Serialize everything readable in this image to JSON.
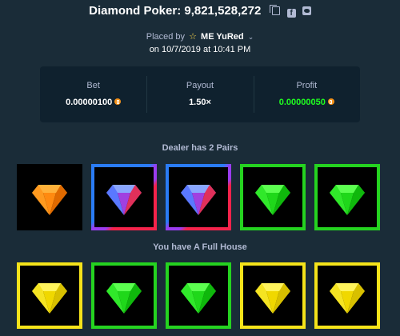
{
  "header": {
    "title": "Diamond Poker: 9,821,528,272"
  },
  "placed": {
    "prefix": "Placed by",
    "username": "ME YuRed",
    "date": "on 10/7/2019 at 10:41 PM"
  },
  "stats": {
    "bet_label": "Bet",
    "bet_value": "0.00000100",
    "payout_label": "Payout",
    "payout_value": "1.50×",
    "profit_label": "Profit",
    "profit_value": "0.00000050"
  },
  "dealer": {
    "title": "Dealer has 2 Pairs",
    "cards": [
      {
        "gem": "orange",
        "frame": "none"
      },
      {
        "gem": "blue-red",
        "frame": "purple"
      },
      {
        "gem": "blue-red",
        "frame": "purple"
      },
      {
        "gem": "green",
        "frame": "green"
      },
      {
        "gem": "green",
        "frame": "green"
      }
    ]
  },
  "player": {
    "title": "You have A Full House",
    "cards": [
      {
        "gem": "yellow",
        "frame": "yellow"
      },
      {
        "gem": "green",
        "frame": "green"
      },
      {
        "gem": "green",
        "frame": "green"
      },
      {
        "gem": "yellow",
        "frame": "yellow"
      },
      {
        "gem": "yellow",
        "frame": "yellow"
      }
    ]
  },
  "colors": {
    "background": "#1a2c38",
    "panel": "#0f212e",
    "profit_green": "#1fff20",
    "frame_yellow": "#f5e31a",
    "frame_green": "#25d320",
    "frame_purple": "#9b3cf0",
    "frame_blue": "#2a7cf5",
    "frame_red": "#f5234b"
  },
  "icons": {
    "copy": "copy-icon",
    "facebook": "facebook-icon",
    "twitter": "twitter-icon",
    "coin": "bitcoin-icon",
    "star": "star-icon"
  }
}
